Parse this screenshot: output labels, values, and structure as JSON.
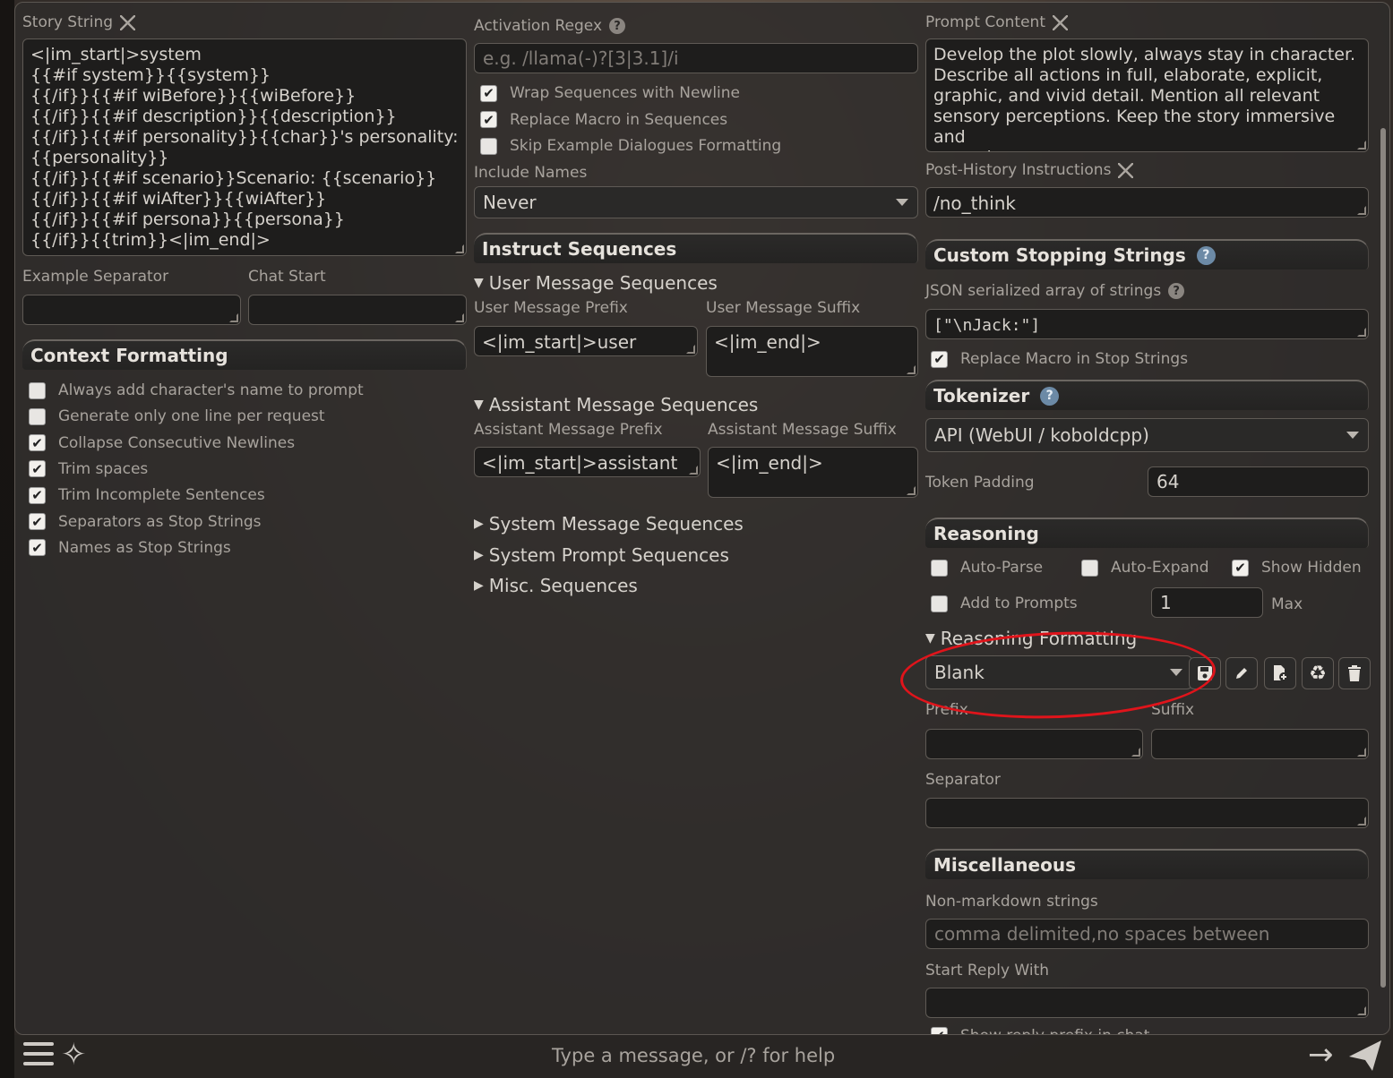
{
  "left": {
    "story_string_label": "Story String",
    "story_string_lines": [
      "<|im_start|>system",
      "{{#if system}}{{system}}",
      "{{/if}}{{#if wiBefore}}{{wiBefore}}",
      "{{/if}}{{#if description}}{{description}}",
      "{{/if}}{{#if personality}}{{char}}'s personality:",
      "{{personality}}",
      "{{/if}}{{#if scenario}}Scenario: {{scenario}}",
      "{{/if}}{{#if wiAfter}}{{wiAfter}}",
      "{{/if}}{{#if persona}}{{persona}}",
      "{{/if}}{{trim}}<|im_end|>"
    ],
    "example_separator_label": "Example Separator",
    "chat_start_label": "Chat Start",
    "context_formatting_title": "Context Formatting",
    "checkboxes": [
      {
        "label": "Always add character's name to prompt",
        "checked": false
      },
      {
        "label": "Generate only one line per request",
        "checked": false
      },
      {
        "label": "Collapse Consecutive Newlines",
        "checked": true
      },
      {
        "label": "Trim spaces",
        "checked": true
      },
      {
        "label": "Trim Incomplete Sentences",
        "checked": true
      },
      {
        "label": "Separators as Stop Strings",
        "checked": true
      },
      {
        "label": "Names as Stop Strings",
        "checked": true
      }
    ]
  },
  "middle": {
    "activation_regex_label": "Activation Regex",
    "activation_regex_placeholder": "e.g. /llama(-)?[3|3.1]/i",
    "checkboxes": [
      {
        "label": "Wrap Sequences with Newline",
        "checked": true
      },
      {
        "label": "Replace Macro in Sequences",
        "checked": true
      },
      {
        "label": "Skip Example Dialogues Formatting",
        "checked": false
      }
    ],
    "include_names_label": "Include Names",
    "include_names_value": "Never",
    "instruct_sequences_title": "Instruct Sequences",
    "user_seq_title": "User Message Sequences",
    "user_prefix_label": "User Message Prefix",
    "user_suffix_label": "User Message Suffix",
    "user_prefix_value": "<|im_start|>user",
    "user_suffix_value": "<|im_end|>",
    "assistant_seq_title": "Assistant Message Sequences",
    "assistant_prefix_label": "Assistant Message Prefix",
    "assistant_suffix_label": "Assistant Message Suffix",
    "assistant_prefix_value": "<|im_start|>assistant",
    "assistant_suffix_value": "<|im_end|>",
    "system_seq_title": "System Message Sequences",
    "system_prompt_seq_title": "System Prompt Sequences",
    "misc_seq_title": "Misc. Sequences"
  },
  "right": {
    "prompt_content_label": "Prompt Content",
    "prompt_content_lines": [
      "Develop the plot slowly, always stay in character.",
      "Describe all actions in full, elaborate, explicit,",
      "graphic, and vivid detail. Mention all relevant",
      "sensory perceptions. Keep the story immersive and",
      "engaging."
    ],
    "post_history_label": "Post-History Instructions",
    "post_history_value": "/no_think",
    "stopping_title": "Custom Stopping Strings",
    "json_label": "JSON serialized array of strings",
    "json_value": "[\"\\nJack:\"]",
    "replace_macro_stop_label": "Replace Macro in Stop Strings",
    "tokenizer_title": "Tokenizer",
    "tokenizer_value": "API (WebUI / koboldcpp)",
    "token_padding_label": "Token Padding",
    "token_padding_value": "64",
    "reasoning_title": "Reasoning",
    "auto_parse_label": "Auto-Parse",
    "auto_expand_label": "Auto-Expand",
    "show_hidden_label": "Show Hidden",
    "add_to_prompts_label": "Add to Prompts",
    "max_value": "1",
    "max_label": "Max",
    "reasoning_formatting_title": "Reasoning Formatting",
    "reasoning_preset_value": "Blank",
    "prefix_label": "Prefix",
    "suffix_label": "Suffix",
    "separator_label": "Separator",
    "misc_title": "Miscellaneous",
    "non_markdown_label": "Non-markdown strings",
    "non_markdown_placeholder": "comma delimited,no spaces between",
    "start_reply_label": "Start Reply With",
    "show_reply_prefix_label": "Show reply prefix in chat"
  },
  "bottom": {
    "message_placeholder": "Type a message, or /? for help"
  },
  "colors": {
    "annotation": "#e0141b",
    "help_badge": "#6c8aa6"
  }
}
